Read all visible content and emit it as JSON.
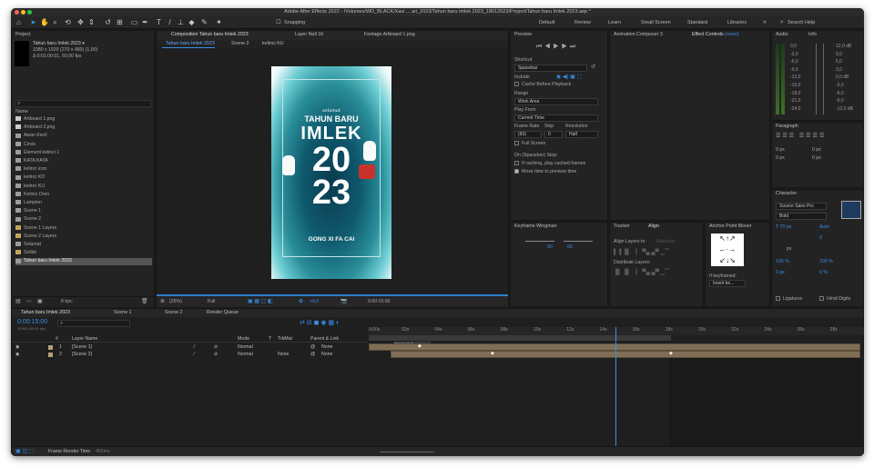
{
  "window": {
    "title": "Adobe After Effects 2022 - /Volumes/WD_BLACK/Xavi ... ari_2023/Tahun baru Imlek 2023_18012023/Project/Tahun baru Imlek 2023.aep *"
  },
  "toolbar": {
    "snapping_label": "Snapping",
    "workspaces": [
      "Default",
      "Review",
      "Learn",
      "Small Screen",
      "Standard",
      "Libraries"
    ],
    "search_help": "Search Help"
  },
  "project": {
    "tab": "Project",
    "comp_name": "Tahun baru Imlek 2023 ▾",
    "comp_info_1": "1080 x 1920 (270 x 480) (1,00)",
    "comp_info_2": "Δ 0:01:00:01, 60,00 fps",
    "col_name": "Name",
    "items": [
      "Artboard 1.png",
      "Artboard 2.png",
      "Awan Kecil",
      "Circle",
      "Element kelinci 1",
      "KATA KATA",
      "kelinci icon",
      "kelinci KD",
      "kelinci KU",
      "Kelinci Oren",
      "Lampion",
      "Scene 1",
      "Scene 2",
      "Scene 1 Layers",
      "Scene 2 Layers",
      "Selamat",
      "Solids",
      "Tahun baru Imlek 2023"
    ],
    "bpc": "8 bpc"
  },
  "comp_panel": {
    "tabs": [
      "Composition Tahun baru Imlek 2023",
      "Layer Null 16",
      "Footage Artboard 1.png"
    ],
    "breadcrumbs": [
      "Tahun baru Imlek 2023",
      "Scene 2",
      "kelinci KU"
    ],
    "zoom": "(25%)",
    "resolution": "Full",
    "exposure": "+0,0",
    "timecode": "0:00:15:00"
  },
  "artwork": {
    "small": "selamat",
    "line1": "TAHUN BARU",
    "line2": "IMLEK",
    "line3": "20",
    "line4": "23",
    "footer": "GONG XI FA CAI"
  },
  "preview": {
    "tab": "Preview",
    "shortcut_label": "Shortcut",
    "shortcut": "Spacebar",
    "include_label": "Include",
    "cache_label": "Cache Before Playback",
    "range_label": "Range",
    "range": "Work Area",
    "playfrom_label": "Play From",
    "playfrom": "Current Time",
    "framerate_label": "Frame Rate",
    "skip_label": "Skip",
    "res_label": "Resolution",
    "framerate": "(60)",
    "skip": "0",
    "res": "Half",
    "fullscreen_label": "Full Screen",
    "stop_label": "On (Spacebar) Stop:",
    "stop_opt1": "If caching, play cached frames",
    "stop_opt2": "Move time to preview time"
  },
  "mid_tabs": {
    "tab1": "Animation Composer 3",
    "tab2": "Effect Controls",
    "tab2_suffix": "(none)"
  },
  "keyframe_wingman": {
    "tab": "Keyframe Wingman",
    "v1": "60",
    "v2": "60"
  },
  "align": {
    "tab_tracker": "Tracker",
    "tab_align": "Align",
    "align_to": "Align Layers to:",
    "selection": "Selection",
    "distribute": "Distribute Layers:"
  },
  "anchor": {
    "tab": "Anchor Point Mover",
    "if_keyframed": "If keyframed:",
    "insert": "Insert ke..."
  },
  "audio": {
    "tab": "Audio",
    "info": "Info",
    "left_scale": [
      "0,0",
      "-3,0",
      "-6,0",
      "-9,0",
      "-12,0",
      "-15,0",
      "-18,0",
      "-21,0",
      "-24,0"
    ],
    "right_scale": [
      "12,0 dB",
      "9,0",
      "6,0",
      "3,0",
      "0,0 dB",
      "-3,0",
      "-6,0",
      "-9,0",
      "-12,0 dB"
    ]
  },
  "paragraph": {
    "tab": "Paragraph",
    "px": [
      "0 px",
      "0 px",
      "0 px",
      "0 px",
      "0 px"
    ]
  },
  "character": {
    "tab": "Character",
    "font": "Source Sans Pro",
    "style": "Bold",
    "size": "70 px",
    "leading": "Auto",
    "tracking": "0",
    "px": "px",
    "vscale": "100 %",
    "hscale": "100 %",
    "baseline": "0 px",
    "tsume": "0 %",
    "ligatures": "Ligatures",
    "hindi": "Hindi Digits"
  },
  "timeline": {
    "tabs": [
      "Tahun baru Imlek 2023",
      "Scene 1",
      "Scene 2",
      "Render Queue"
    ],
    "timecode": "0:00:15:00",
    "timecode_sub": "00900 (60.00 fps)",
    "cols": [
      "#",
      "Layer Name",
      "Mode",
      "T",
      "TrkMat",
      "Parent & Link"
    ],
    "layers": [
      {
        "num": "1",
        "name": "[Scene 1]",
        "mode": "Normal",
        "trk": "",
        "parent": "None"
      },
      {
        "num": "2",
        "name": "[Scene 2]",
        "mode": "Normal",
        "trk": "None",
        "parent": "None"
      }
    ],
    "ruler": [
      "0:00s",
      "02s",
      "04s",
      "06s",
      "08s",
      "10s",
      "12s",
      "14s",
      "16s",
      "18s",
      "20s",
      "22s",
      "24s",
      "26s",
      "28s"
    ],
    "marker": "Scene 2 in",
    "render_time": "Frame Render Time",
    "render_time_val": "465ms"
  }
}
